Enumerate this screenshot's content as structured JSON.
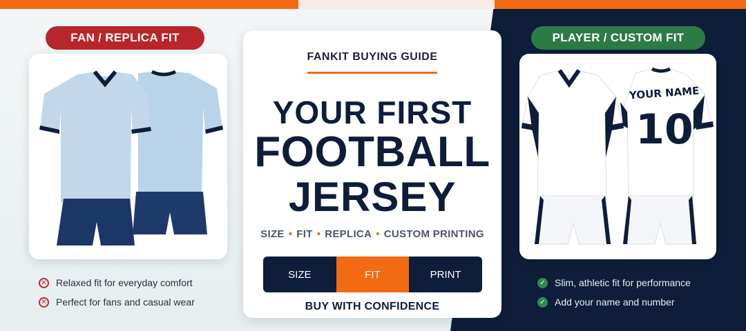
{
  "left_panel": {
    "badge": "FAN / REPLICA FIT",
    "benefits": [
      "Relaxed fit for everyday comfort",
      "Perfect for fans and casual wear"
    ]
  },
  "right_panel": {
    "badge": "PLAYER / CUSTOM FIT",
    "jersey_name": "YOUR NAME",
    "jersey_number": "10",
    "benefits": [
      "Slim, athletic fit for performance",
      "Add your name and number"
    ]
  },
  "center": {
    "guide_label": "FANKIT BUYING GUIDE",
    "headline": [
      "YOUR FIRST",
      "FOOTBALL",
      "JERSEY"
    ],
    "topics": [
      "SIZE",
      "FIT",
      "REPLICA",
      "CUSTOM PRINTING"
    ],
    "tabs": [
      {
        "label": "SIZE",
        "active": false
      },
      {
        "label": "FIT",
        "active": true
      },
      {
        "label": "PRINT",
        "active": false
      }
    ],
    "cta": "BUY WITH CONFIDENCE"
  },
  "icons": {
    "fan_bullet": "x-circle-icon",
    "player_bullet": "check-circle-icon"
  },
  "colors": {
    "accent": "#f26a12",
    "navy": "#0e1d3a",
    "fan_badge": "#b8262b",
    "player_badge": "#2d7a45",
    "fan_jersey": "#b9d3e8"
  }
}
